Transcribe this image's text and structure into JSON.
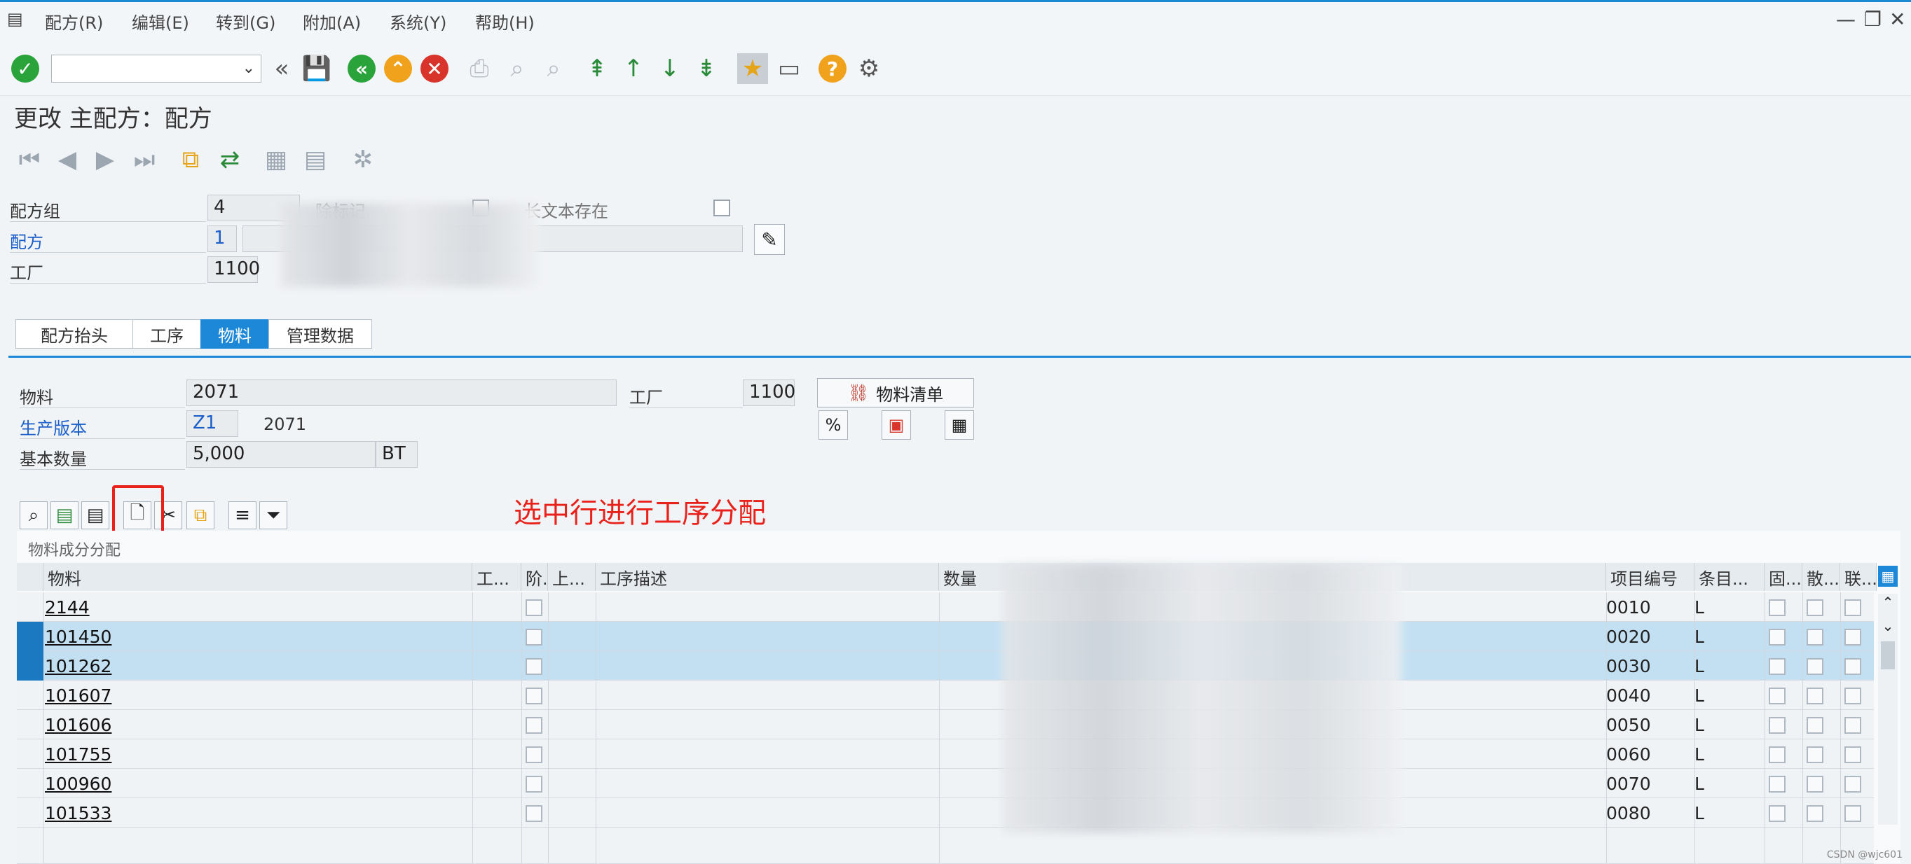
{
  "menu": {
    "items": [
      "配方(R)",
      "编辑(E)",
      "转到(G)",
      "附加(A)",
      "系统(Y)",
      "帮助(H)"
    ],
    "window_controls": [
      "—",
      "❐",
      "✕"
    ]
  },
  "page_title": "更改 主配方：配方",
  "header": {
    "recipe_group_label": "配方组",
    "recipe_group_value": "4",
    "deletion_flag_label": "除标记",
    "long_text_label": "长文本存在",
    "recipe_label": "配方",
    "recipe_value": "1",
    "plant_label": "工厂",
    "plant_value": "1100"
  },
  "tabs": [
    "配方抬头",
    "工序",
    "物料",
    "管理数据"
  ],
  "active_tab": "物料",
  "material_section": {
    "material_label": "物料",
    "material_value": "2071",
    "plant_label": "工厂",
    "plant_value": "1100",
    "production_version_label": "生产版本",
    "production_version_value": "Z1",
    "production_version_text": "2071",
    "base_qty_label": "基本数量",
    "base_qty_value": "5,000",
    "base_qty_unit": "BT",
    "bom_button_label": "物料清单"
  },
  "annotation": "选中行进行工序分配",
  "table": {
    "title": "物料成分分配",
    "columns": [
      "物料",
      "工...",
      "阶.",
      "上...",
      "工序描述",
      "数量",
      "项目编号",
      "条目...",
      "固...",
      "散...",
      "联..."
    ],
    "rows": [
      {
        "material": "2144",
        "item": "0010",
        "cat": "L",
        "selected": false
      },
      {
        "material": "101450",
        "item": "0020",
        "cat": "L",
        "selected": true
      },
      {
        "material": "101262",
        "item": "0030",
        "cat": "L",
        "selected": true
      },
      {
        "material": "101607",
        "item": "0040",
        "cat": "L",
        "selected": false
      },
      {
        "material": "101606",
        "item": "0050",
        "cat": "L",
        "selected": false
      },
      {
        "material": "101755",
        "item": "0060",
        "cat": "L",
        "selected": false
      },
      {
        "material": "100960",
        "item": "0070",
        "cat": "L",
        "selected": false
      },
      {
        "material": "101533",
        "item": "0080",
        "cat": "L",
        "selected": false
      }
    ]
  },
  "watermark": "CSDN @wjc601",
  "colors": {
    "accent": "#1e88d8",
    "annotation": "#e8221b",
    "selected_row": "#c3e0f2"
  }
}
